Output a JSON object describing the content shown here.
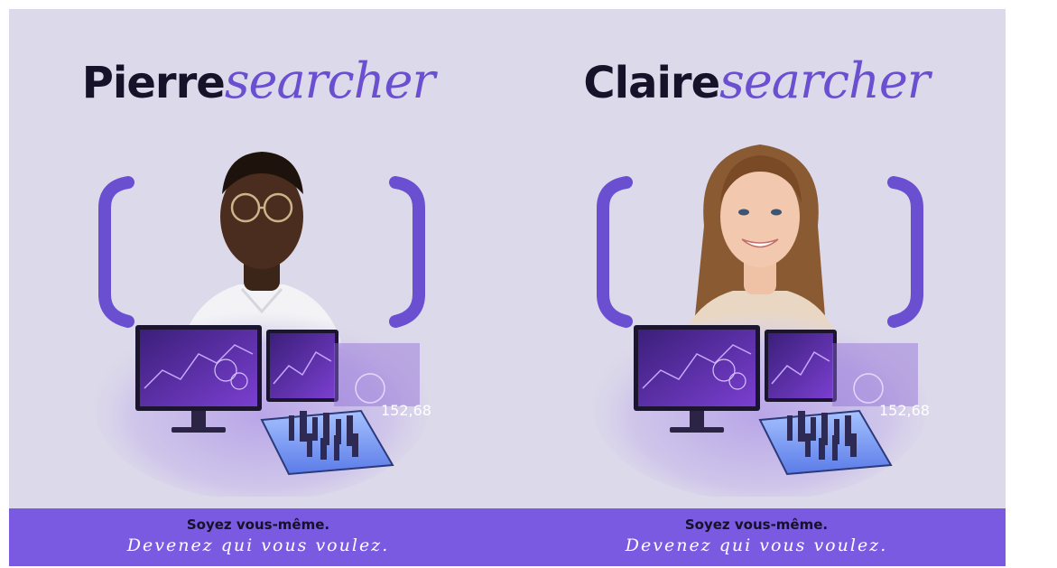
{
  "posters": [
    {
      "title_bold": "Pierre",
      "title_script": "searcher",
      "tagline": "Soyez vous-même.",
      "tagline_script": "Devenez qui vous voulez.",
      "screen_number": "152,68"
    },
    {
      "title_bold": "Claire",
      "title_script": "searcher",
      "tagline": "Soyez vous-même.",
      "tagline_script": "Devenez qui vous voulez.",
      "screen_number": "152,68"
    }
  ],
  "colors": {
    "background": "#dcd9ea",
    "accent_purple": "#6a4fd1",
    "banner": "#7a5ae0",
    "title_dark": "#16122a"
  }
}
